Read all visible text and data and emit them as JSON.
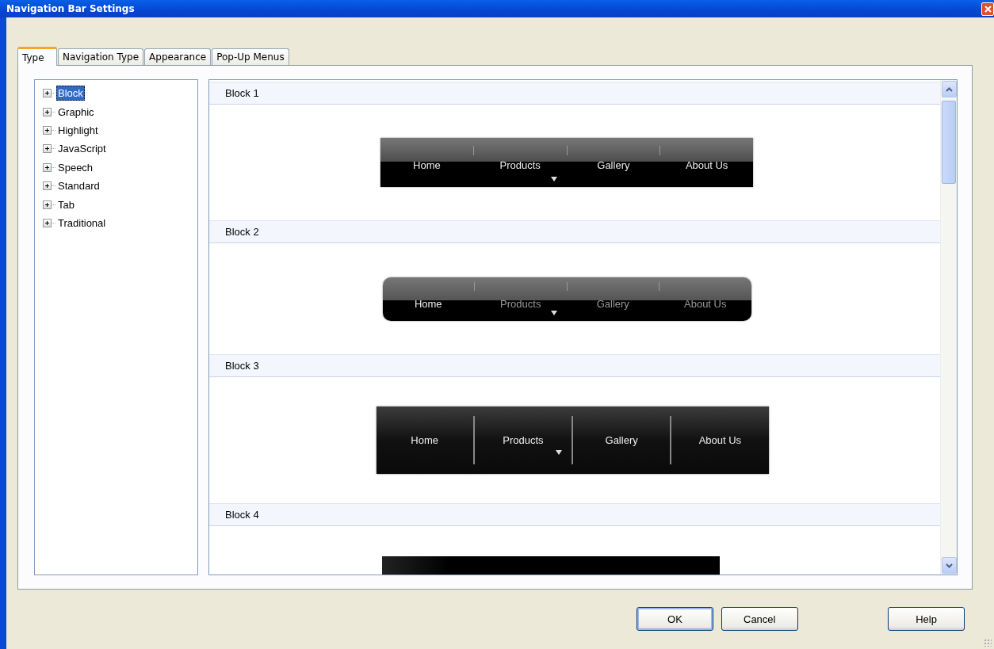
{
  "window": {
    "title": "Navigation Bar Settings"
  },
  "tabs": [
    {
      "label": "Type",
      "selected": true
    },
    {
      "label": "Navigation Type",
      "selected": false
    },
    {
      "label": "Appearance",
      "selected": false
    },
    {
      "label": "Pop-Up Menus",
      "selected": false
    }
  ],
  "tree": {
    "items": [
      {
        "label": "Block",
        "selected": true,
        "expanded": false
      },
      {
        "label": "Graphic",
        "selected": false,
        "expanded": false
      },
      {
        "label": "Highlight",
        "selected": false,
        "expanded": false
      },
      {
        "label": "JavaScript",
        "selected": false,
        "expanded": false
      },
      {
        "label": "Speech",
        "selected": false,
        "expanded": false
      },
      {
        "label": "Standard",
        "selected": false,
        "expanded": false
      },
      {
        "label": "Tab",
        "selected": false,
        "expanded": false
      },
      {
        "label": "Traditional",
        "selected": false,
        "expanded": false
      }
    ]
  },
  "previews": [
    {
      "title": "Block 1",
      "kind": "gloss",
      "items": [
        {
          "label": "Home",
          "submenu": false
        },
        {
          "label": "Products",
          "submenu": true
        },
        {
          "label": "Gallery",
          "submenu": false
        },
        {
          "label": "About Us",
          "submenu": false
        }
      ]
    },
    {
      "title": "Block 2",
      "kind": "rounded",
      "items": [
        {
          "label": "Home",
          "submenu": false,
          "selected": true
        },
        {
          "label": "Products",
          "submenu": true,
          "selected": false
        },
        {
          "label": "Gallery",
          "submenu": false,
          "selected": false
        },
        {
          "label": "About Us",
          "submenu": false,
          "selected": false
        }
      ]
    },
    {
      "title": "Block 3",
      "kind": "dark",
      "items": [
        {
          "label": "Home",
          "submenu": false
        },
        {
          "label": "Products",
          "submenu": true
        },
        {
          "label": "Gallery",
          "submenu": false
        },
        {
          "label": "About Us",
          "submenu": false
        }
      ]
    },
    {
      "title": "Block 4",
      "kind": "flat"
    }
  ],
  "buttons": [
    {
      "label": "OK",
      "default": true
    },
    {
      "label": "Cancel",
      "default": false
    },
    {
      "label": "Help",
      "default": false
    }
  ]
}
